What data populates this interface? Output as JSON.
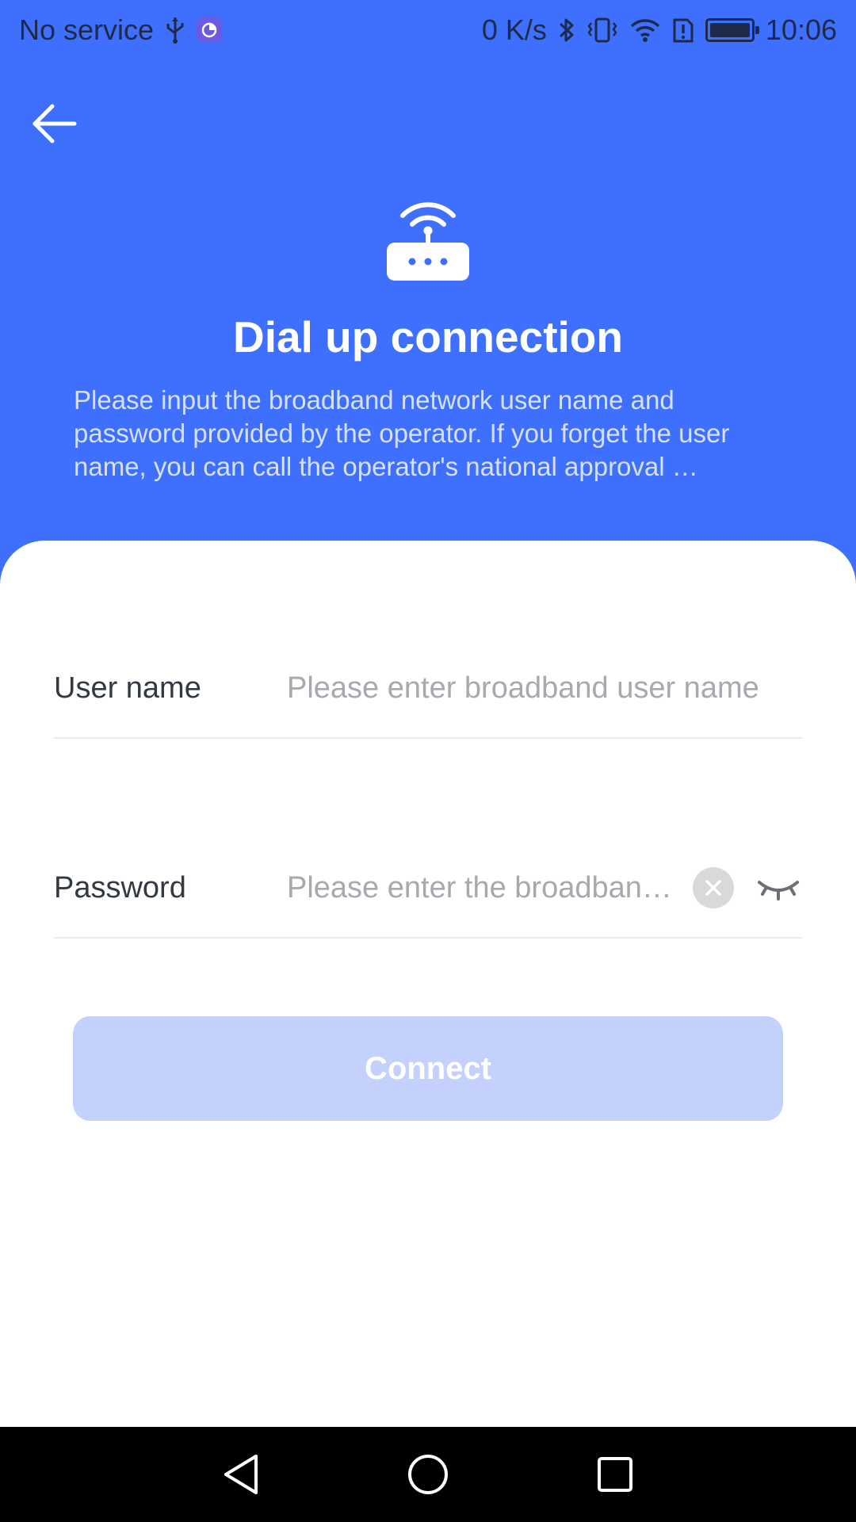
{
  "status_bar": {
    "carrier": "No service",
    "network_speed": "0 K/s",
    "time": "10:06",
    "icons": [
      "usb-icon",
      "app-notification-icon",
      "bluetooth-icon",
      "vibrate-icon",
      "wifi-icon",
      "alert-icon",
      "battery-charging-icon"
    ]
  },
  "header": {
    "title": "Dial up connection",
    "description": "Please input the broadband network user name and password provided by the operator. If you forget the user name, you can call the operator's national approval …"
  },
  "form": {
    "username": {
      "label": "User name",
      "value": "",
      "placeholder": "Please enter broadband user name"
    },
    "password": {
      "label": "Password",
      "value": "",
      "placeholder": "Please enter the broadban…"
    },
    "connect_label": "Connect"
  },
  "colors": {
    "primary": "#3f6ffd",
    "button_disabled": "#c4d1fd",
    "card": "#ffffff"
  }
}
